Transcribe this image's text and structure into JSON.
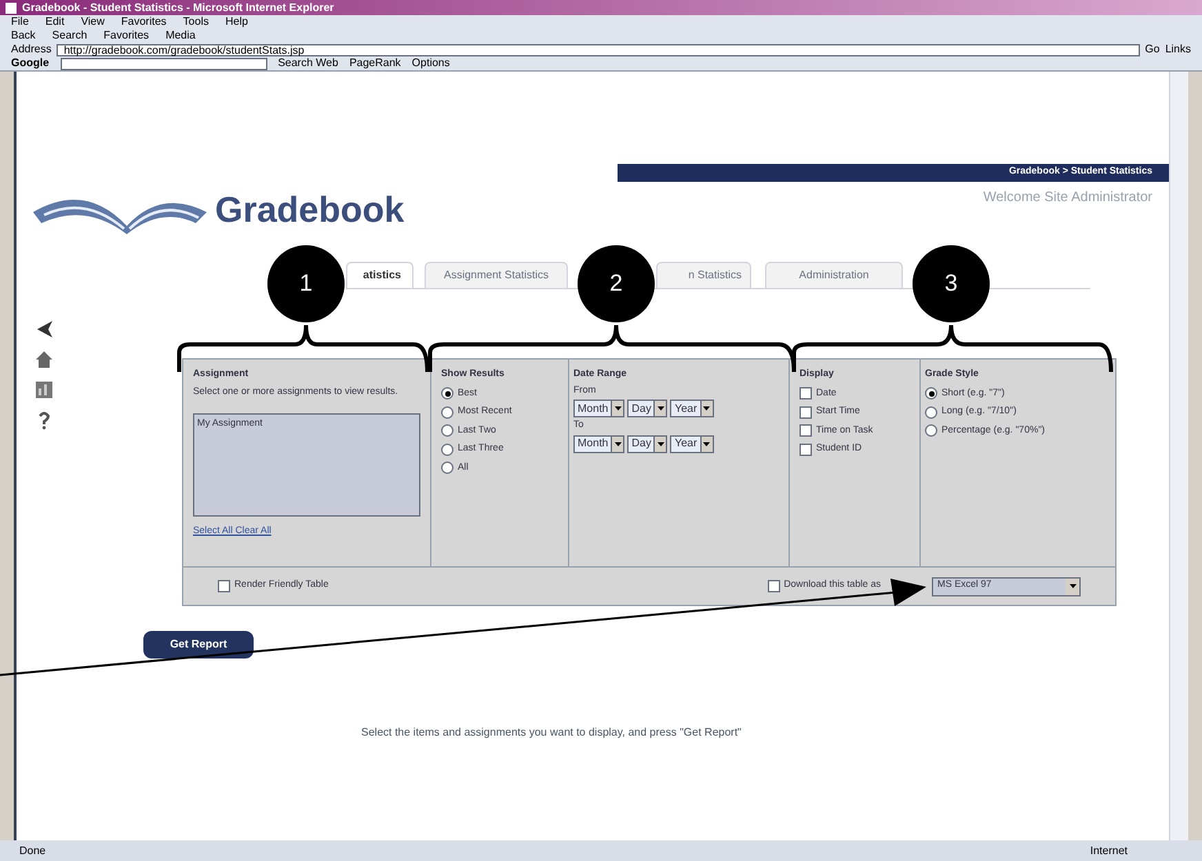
{
  "window": {
    "title": "Gradebook - Student Statistics - Microsoft Internet Explorer"
  },
  "menu": [
    "File",
    "Edit",
    "View",
    "Favorites",
    "Tools",
    "Help"
  ],
  "toolbar": [
    "Back",
    "Search",
    "Favorites",
    "Media"
  ],
  "address": {
    "label": "Address",
    "value": "http://gradebook.com/gradebook/studentStats.jsp",
    "go": "Go",
    "links": "Links"
  },
  "google_bar": {
    "label": "Google",
    "buttons": [
      "Search Web",
      "PageRank",
      "Options"
    ]
  },
  "breadcrumb": "Gradebook > Student Statistics",
  "logo": "Gradebook",
  "user": "Welcome Site Administrator",
  "tabs": [
    {
      "label": "atistics",
      "selected": true
    },
    {
      "label": "Assignment Statistics",
      "selected": false
    },
    {
      "label": "n Statistics",
      "selected": false
    },
    {
      "label": "Administration",
      "selected": false
    }
  ],
  "assignment": {
    "heading": "Assignment",
    "hint": "Select one or more assignments to view results.",
    "items": [
      "My Assignment"
    ],
    "link": "Select All Clear All"
  },
  "show_results": {
    "heading": "Show Results",
    "options": [
      {
        "label": "Best",
        "selected": true
      },
      {
        "label": "Most Recent",
        "selected": false
      },
      {
        "label": "Last Two",
        "selected": false
      },
      {
        "label": "Last Three",
        "selected": false
      },
      {
        "label": "All",
        "selected": false
      }
    ]
  },
  "date_range": {
    "heading": "Date Range",
    "rows": [
      {
        "label": "From",
        "fields": [
          "Month",
          "Day",
          "Year"
        ]
      },
      {
        "label": "To",
        "fields": [
          "Month",
          "Day",
          "Year"
        ]
      }
    ]
  },
  "display": {
    "heading": "Display",
    "options": [
      {
        "label": "Date",
        "checked": false
      },
      {
        "label": "Start Time",
        "checked": false
      },
      {
        "label": "Time on Task",
        "checked": false
      },
      {
        "label": "Student ID",
        "checked": false
      }
    ]
  },
  "grade_style": {
    "heading": "Grade Style",
    "options": [
      {
        "label": "Short (e.g. \"7\")",
        "selected": true
      },
      {
        "label": "Long (e.g. \"7/10\")",
        "selected": false
      },
      {
        "label": "Percentage (e.g. \"70%\")",
        "selected": false
      }
    ]
  },
  "render_friendly": {
    "label": "Render Friendly Table",
    "checked": false
  },
  "download": {
    "label": "Download this table as",
    "checked": false,
    "format": "MS Excel 97"
  },
  "get_report": "Get Report",
  "instruction": "Select the items and assignments you want to display, and press \"Get Report\"",
  "callouts": [
    "1",
    "2",
    "3"
  ],
  "status_bar": {
    "left": "Done",
    "right": "Internet"
  }
}
